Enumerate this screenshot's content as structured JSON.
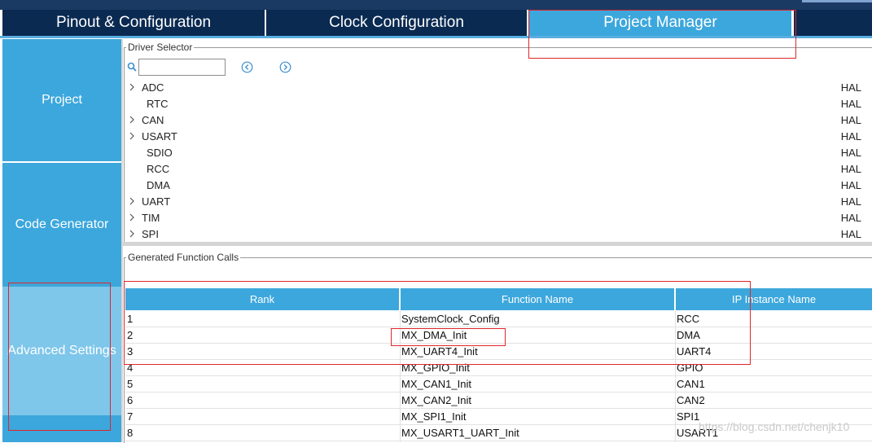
{
  "tabs": [
    {
      "label": "Pinout & Configuration"
    },
    {
      "label": "Clock Configuration"
    },
    {
      "label": "Project Manager"
    }
  ],
  "sidebar": {
    "items": [
      {
        "label": "Project"
      },
      {
        "label": "Code Generator"
      },
      {
        "label": "Advanced Settings"
      }
    ]
  },
  "driver_selector": {
    "legend": "Driver Selector",
    "search_value": "",
    "rows": [
      {
        "name": "ADC",
        "lib": "HAL",
        "expandable": true
      },
      {
        "name": "RTC",
        "lib": "HAL",
        "expandable": false
      },
      {
        "name": "CAN",
        "lib": "HAL",
        "expandable": true
      },
      {
        "name": "USART",
        "lib": "HAL",
        "expandable": true
      },
      {
        "name": "SDIO",
        "lib": "HAL",
        "expandable": false
      },
      {
        "name": "RCC",
        "lib": "HAL",
        "expandable": false
      },
      {
        "name": "DMA",
        "lib": "HAL",
        "expandable": false
      },
      {
        "name": "UART",
        "lib": "HAL",
        "expandable": true
      },
      {
        "name": "TIM",
        "lib": "HAL",
        "expandable": true
      },
      {
        "name": "SPI",
        "lib": "HAL",
        "expandable": true
      }
    ]
  },
  "function_calls": {
    "legend": "Generated Function Calls",
    "columns": [
      "Rank",
      "Function Name",
      "IP Instance Name"
    ],
    "rows": [
      [
        "1",
        "SystemClock_Config",
        "RCC"
      ],
      [
        "2",
        "MX_DMA_Init",
        "DMA"
      ],
      [
        "3",
        "MX_UART4_Init",
        "UART4"
      ],
      [
        "4",
        "MX_GPIO_Init",
        "GPIO"
      ],
      [
        "5",
        "MX_CAN1_Init",
        "CAN1"
      ],
      [
        "6",
        "MX_CAN2_Init",
        "CAN2"
      ],
      [
        "7",
        "MX_SPI1_Init",
        "SPI1"
      ],
      [
        "8",
        "MX_USART1_UART_Init",
        "USART1"
      ]
    ]
  },
  "watermark": "https://blog.csdn.net/chenjk10",
  "colors": {
    "tab_dark": "#0a2a52",
    "accent_blue": "#3ca7dc",
    "sidebar_selected": "#7ec6ea",
    "annotation_red": "#e0262b"
  },
  "icons": [
    "search-icon",
    "nav-left-icon",
    "nav-right-icon",
    "chevron-right-icon"
  ]
}
